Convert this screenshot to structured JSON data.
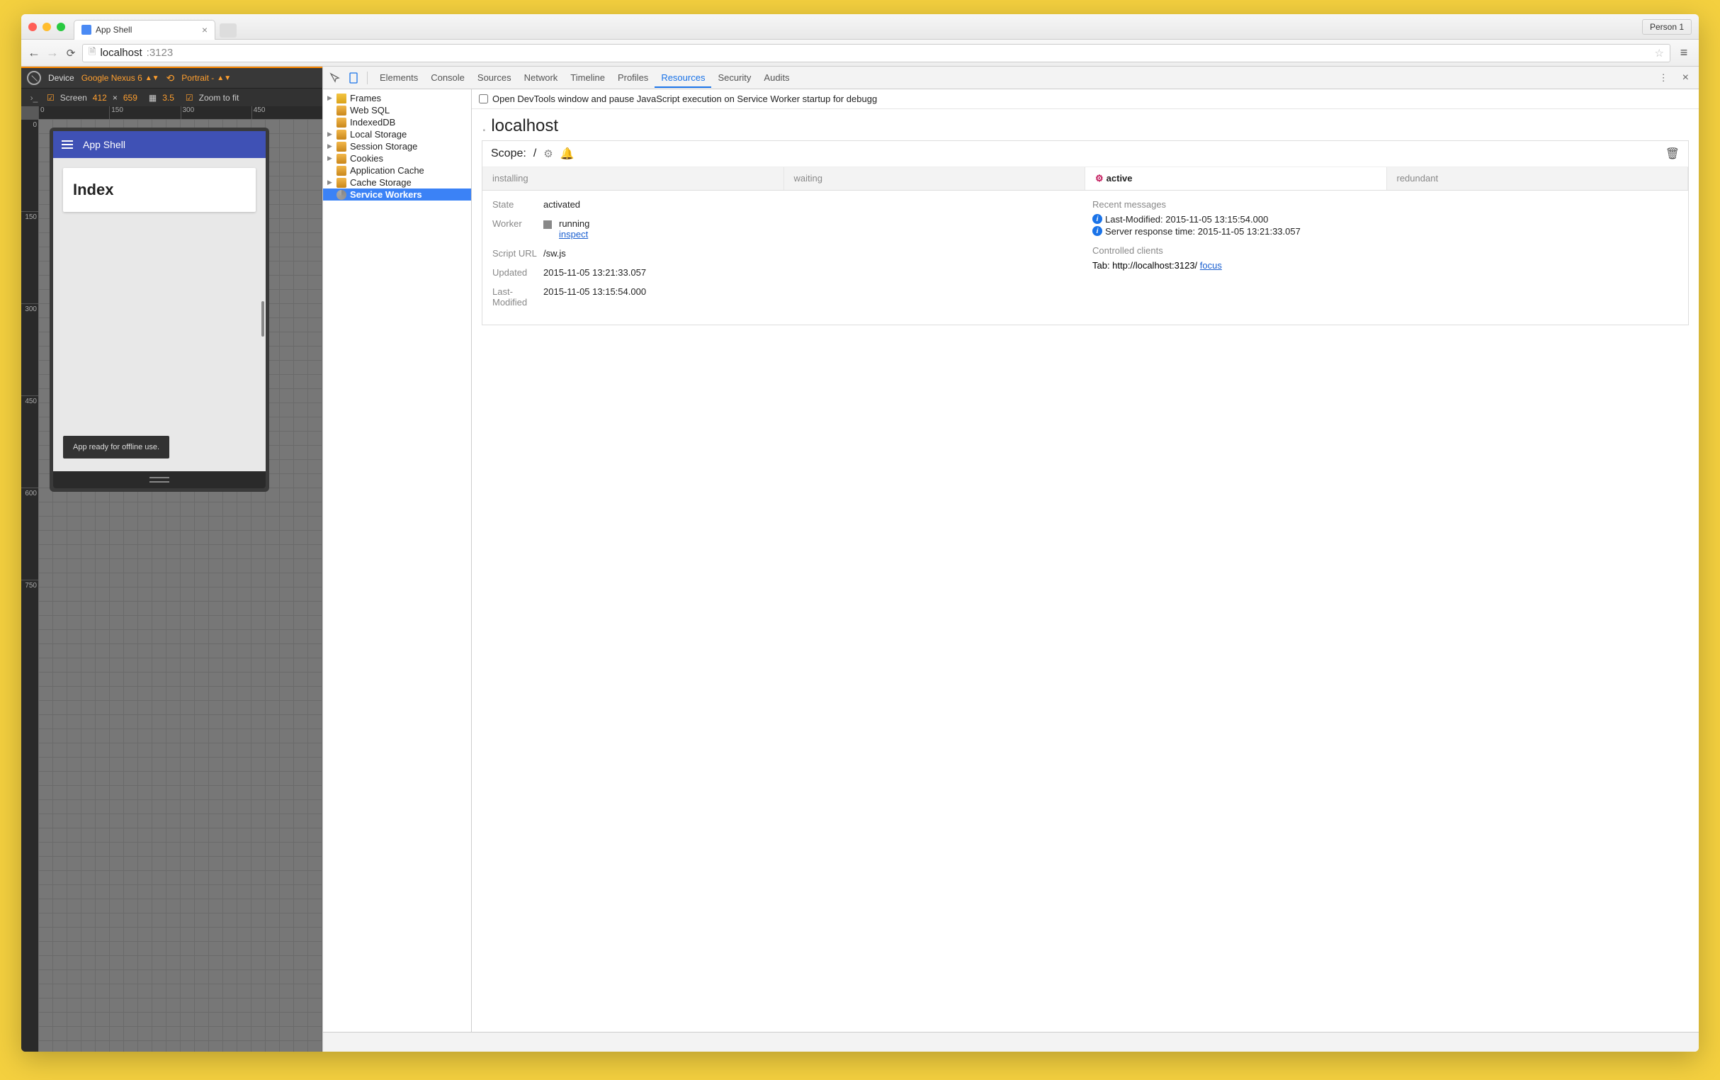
{
  "browser": {
    "tab_title": "App Shell",
    "profile_label": "Person 1",
    "url_host": "localhost",
    "url_port": ":3123"
  },
  "device_toolbar": {
    "device_label": "Device",
    "device_selected": "Google Nexus 6",
    "orientation": "Portrait -",
    "screen_label": "Screen",
    "screen_w": "412",
    "screen_x": "×",
    "screen_h": "659",
    "dpr": "3.5",
    "zoom_label": "Zoom to fit"
  },
  "rulers": {
    "top": [
      "0",
      "150",
      "300",
      "450"
    ],
    "left": [
      "0",
      "150",
      "300",
      "450",
      "600",
      "750"
    ]
  },
  "app": {
    "header_title": "App Shell",
    "card_title": "Index",
    "toast": "App ready for offline use."
  },
  "devtools": {
    "tabs": [
      "Elements",
      "Console",
      "Sources",
      "Network",
      "Timeline",
      "Profiles",
      "Resources",
      "Security",
      "Audits"
    ],
    "active_tab": "Resources",
    "option_text": "Open DevTools window and pause JavaScript execution on Service Worker startup for debugg",
    "tree": [
      {
        "label": "Frames",
        "icon": "folder-y",
        "arrow": true
      },
      {
        "label": "Web SQL",
        "icon": "db-ic"
      },
      {
        "label": "IndexedDB",
        "icon": "db-ic"
      },
      {
        "label": "Local Storage",
        "icon": "db-ic",
        "arrow": true
      },
      {
        "label": "Session Storage",
        "icon": "db-ic",
        "arrow": true
      },
      {
        "label": "Cookies",
        "icon": "db-ic",
        "arrow": true
      },
      {
        "label": "Application Cache",
        "icon": "db-ic"
      },
      {
        "label": "Cache Storage",
        "icon": "db-ic",
        "arrow": true
      },
      {
        "label": "Service Workers",
        "icon": "gear-ic",
        "selected": true
      }
    ],
    "sw": {
      "host": "localhost",
      "scope_label": "Scope:",
      "scope_value": "/",
      "status_tabs": [
        "installing",
        "waiting",
        "active",
        "redundant"
      ],
      "active_status": "active",
      "state_label": "State",
      "state_value": "activated",
      "worker_label": "Worker",
      "worker_status": "running",
      "worker_link": "inspect",
      "script_label": "Script URL",
      "script_value": "/sw.js",
      "updated_label": "Updated",
      "updated_value": "2015-11-05 13:21:33.057",
      "lastmod_label": "Last-Modified",
      "lastmod_value": "2015-11-05 13:15:54.000",
      "recent_label": "Recent messages",
      "messages": [
        "Last-Modified: 2015-11-05 13:15:54.000",
        "Server response time: 2015-11-05 13:21:33.057"
      ],
      "clients_label": "Controlled clients",
      "client_prefix": "Tab: http://localhost:3123/ ",
      "client_link": "focus"
    }
  }
}
